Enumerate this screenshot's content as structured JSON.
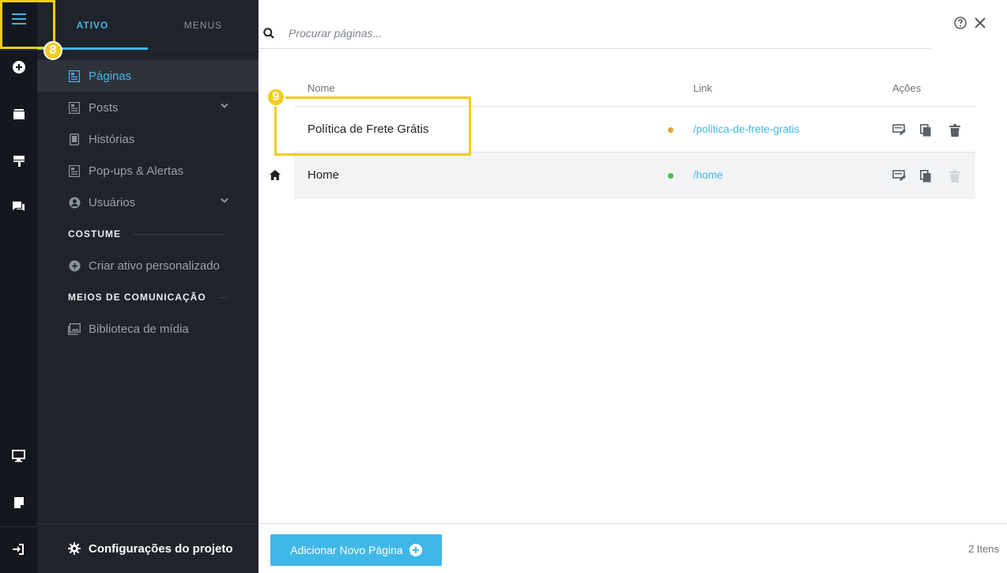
{
  "sidebar": {
    "tabs": [
      {
        "label": "ATIVO",
        "active": true
      },
      {
        "label": "MENUS",
        "active": false
      }
    ],
    "items": [
      {
        "label": "Páginas",
        "icon": "page-icon",
        "selected": true,
        "has_chevron": false
      },
      {
        "label": "Posts",
        "icon": "post-icon",
        "selected": false,
        "has_chevron": true
      },
      {
        "label": "Histórias",
        "icon": "story-icon",
        "selected": false,
        "has_chevron": false
      },
      {
        "label": "Pop-ups & Alertas",
        "icon": "popup-icon",
        "selected": false,
        "has_chevron": false
      },
      {
        "label": "Usuários",
        "icon": "user-icon",
        "selected": false,
        "has_chevron": true
      }
    ],
    "section_custom": "COSTUME",
    "custom_item": "Criar ativo personalizado",
    "section_media": "MEIOS DE COMUNICAÇÃO",
    "media_item": "Biblioteca de mídia",
    "settings_label": "Configurações do projeto"
  },
  "search": {
    "placeholder": "Procurar páginas..."
  },
  "table": {
    "columns": [
      "Nome",
      "Link",
      "Ações"
    ],
    "rows": [
      {
        "name": "Política de Frete Grátis",
        "link": "/politica-de-frete-gratis",
        "status_color": "#e3a72f",
        "is_home": false,
        "delete_enabled": true
      },
      {
        "name": "Home",
        "link": "/home",
        "status_color": "#3cc43c",
        "is_home": true,
        "delete_enabled": false
      }
    ]
  },
  "footer": {
    "add_button_label": "Adicionar Novo Página",
    "items_count": "2 Itens"
  },
  "annotations": {
    "badge_menu": "8",
    "badge_row": "9"
  },
  "colors": {
    "accent": "#3fb8e8",
    "highlight": "#f2cd1a",
    "sidebar_bg": "#1f232a",
    "rail_bg": "#14171d"
  }
}
